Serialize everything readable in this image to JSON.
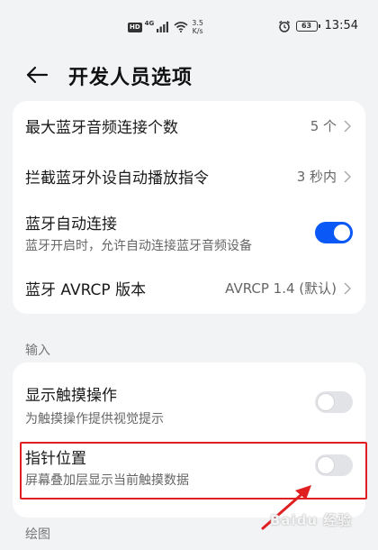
{
  "status_bar": {
    "hd_badge": "HD",
    "network": "4G",
    "speed_value": "3.5",
    "speed_unit": "K/s",
    "battery_level": "63",
    "time": "13:54"
  },
  "header": {
    "title": "开发人员选项"
  },
  "bluetooth_card": {
    "rows": [
      {
        "title": "最大蓝牙音频连接个数",
        "value": "5 个"
      },
      {
        "title": "拦截蓝牙外设自动播放指令",
        "value": "3 秒内"
      },
      {
        "title": "蓝牙自动连接",
        "subtitle": "蓝牙开启时，允许自动连接蓝牙音频设备",
        "toggle_on": true
      },
      {
        "title": "蓝牙 AVRCP 版本",
        "value": "AVRCP 1.4 (默认)"
      }
    ]
  },
  "input_section": {
    "header": "输入",
    "rows": [
      {
        "title": "显示触摸操作",
        "subtitle": "为触摸操作提供视觉提示",
        "toggle_on": false
      },
      {
        "title": "指针位置",
        "subtitle": "屏幕叠加层显示当前触摸数据",
        "toggle_on": false
      }
    ]
  },
  "drawing_section": {
    "header": "绘图"
  },
  "annotation": {
    "highlight_color": "#e02020"
  },
  "watermark": {
    "text": "Baidu 经验"
  },
  "colors": {
    "accent": "#0a59f7",
    "background": "#f1f3f5",
    "card": "#ffffff"
  }
}
